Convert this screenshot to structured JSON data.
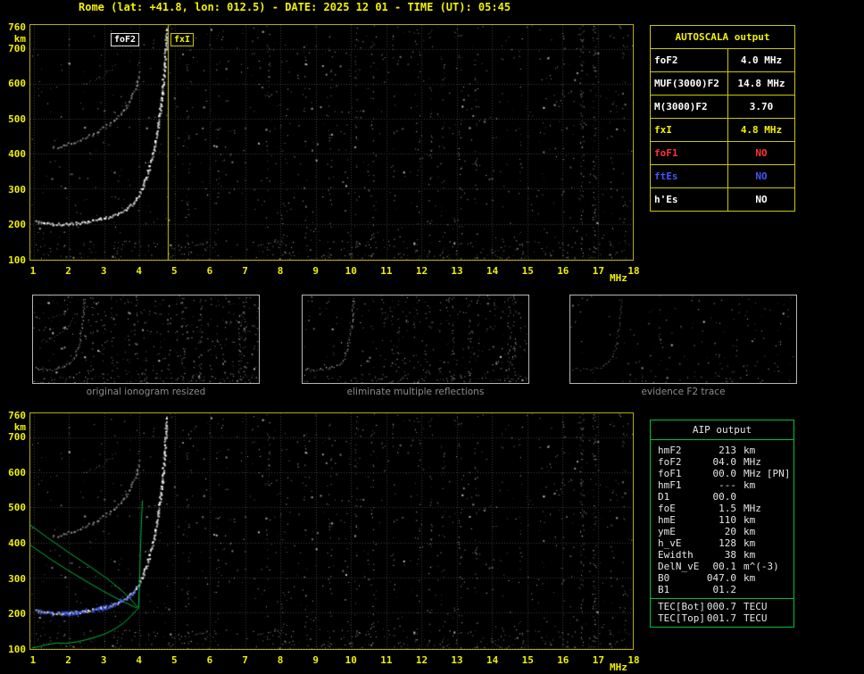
{
  "title": "Rome (lat: +41.8, lon: 012.5) - DATE: 2025 12 01 - TIME (UT): 05:45",
  "colors": {
    "yellow_text": "#f2f200",
    "yellow_border": "#c9c900",
    "green": "#00c040",
    "blue": "#3355ff",
    "red": "#ff3333",
    "ftes_blue": "#4455ff",
    "white": "#ffffff",
    "caption_gray": "#8c8c8c",
    "grid": "#3d3d3d"
  },
  "plot_labels": {
    "foF2": "foF2",
    "fxI": "fxI"
  },
  "axes": {
    "y_unit": "km",
    "x_unit": "MHz",
    "y_ticks": [
      760,
      700,
      600,
      500,
      400,
      300,
      200,
      100
    ],
    "y_grid": [
      100,
      200,
      300,
      400,
      500,
      600,
      700
    ],
    "x_ticks": [
      1,
      2,
      3,
      4,
      5,
      6,
      7,
      8,
      9,
      10,
      11,
      12,
      13,
      14,
      15,
      16,
      17,
      18
    ]
  },
  "autoscala_table": {
    "title": "AUTOSCALA output",
    "rows": [
      {
        "label": "foF2",
        "value": "4.0 MHz",
        "color": "#ffffff"
      },
      {
        "label": "MUF(3000)F2",
        "value": "14.8 MHz",
        "color": "#ffffff"
      },
      {
        "label": "M(3000)F2",
        "value": "3.70",
        "color": "#ffffff"
      },
      {
        "label": "fxI",
        "value": "4.8 MHz",
        "color": "#f2f200"
      },
      {
        "label": "foF1",
        "value": "NO",
        "color": "#ff3333"
      },
      {
        "label": "ftEs",
        "value": "NO",
        "color": "#4455ff"
      },
      {
        "label": "h'Es",
        "value": "NO",
        "color": "#ffffff"
      }
    ]
  },
  "thumbnails": [
    {
      "caption": "original ionogram resized"
    },
    {
      "caption": "eliminate multiple reflections"
    },
    {
      "caption": "evidence F2 trace"
    }
  ],
  "aip_table": {
    "title": "AIP output",
    "rows": [
      {
        "name": "hmF2",
        "value": "213",
        "unit": "km",
        "extra": ""
      },
      {
        "name": "foF2",
        "value": "04.0",
        "unit": "MHz",
        "extra": ""
      },
      {
        "name": "foF1",
        "value": "00.0",
        "unit": "MHz",
        "extra": "[PN]"
      },
      {
        "name": "hmF1",
        "value": "---",
        "unit": "km",
        "extra": ""
      },
      {
        "name": "D1",
        "value": "00.0",
        "unit": "",
        "extra": ""
      },
      {
        "name": "foE",
        "value": "1.5",
        "unit": "MHz",
        "extra": ""
      },
      {
        "name": "hmE",
        "value": "110",
        "unit": "km",
        "extra": ""
      },
      {
        "name": "ymE",
        "value": "20",
        "unit": "km",
        "extra": ""
      },
      {
        "name": "h_vE",
        "value": "128",
        "unit": "km",
        "extra": ""
      },
      {
        "name": "Ewidth",
        "value": "38",
        "unit": "km",
        "extra": ""
      },
      {
        "name": "DelN_vE",
        "value": "00.1",
        "unit": "m^(-3)",
        "extra": ""
      },
      {
        "name": "B0",
        "value": "047.0",
        "unit": "km",
        "extra": ""
      },
      {
        "name": "B1",
        "value": "01.2",
        "unit": "",
        "extra": ""
      }
    ],
    "tec_rows": [
      {
        "name": "TEC[Bot]",
        "value": "000.7",
        "unit": "TECU"
      },
      {
        "name": "TEC[Top]",
        "value": "001.7",
        "unit": "TECU"
      }
    ]
  },
  "ionogram": {
    "fmin": 0.9,
    "fmax": 18.0,
    "hmin": 97,
    "hmax": 768,
    "foF2_mhz": 4.0,
    "fxI_mhz": 4.8,
    "seed": 11,
    "traces": {
      "f2": [
        [
          1.05,
          207
        ],
        [
          1.4,
          201
        ],
        [
          1.8,
          200
        ],
        [
          2.2,
          203
        ],
        [
          2.6,
          209
        ],
        [
          3.0,
          217
        ],
        [
          3.3,
          227
        ],
        [
          3.6,
          241
        ],
        [
          3.8,
          259
        ],
        [
          3.95,
          281
        ],
        [
          4.1,
          312
        ],
        [
          4.25,
          355
        ],
        [
          4.4,
          410
        ],
        [
          4.5,
          470
        ],
        [
          4.62,
          560
        ],
        [
          4.7,
          650
        ],
        [
          4.75,
          760
        ]
      ],
      "hop2": [
        [
          1.5,
          418
        ],
        [
          1.9,
          428
        ],
        [
          2.3,
          442
        ],
        [
          2.7,
          460
        ],
        [
          3.0,
          478
        ],
        [
          3.3,
          500
        ],
        [
          3.55,
          528
        ],
        [
          3.75,
          560
        ],
        [
          3.9,
          600
        ],
        [
          4.0,
          640
        ]
      ],
      "hop3": [
        [
          2.4,
          598
        ],
        [
          2.7,
          610
        ],
        [
          3.0,
          625
        ],
        [
          3.2,
          642
        ],
        [
          3.35,
          660
        ]
      ]
    },
    "green_paths": [
      [
        [
          0.95,
          100
        ],
        [
          1.15,
          104
        ],
        [
          1.4,
          110
        ],
        [
          1.65,
          114
        ],
        [
          1.9,
          113
        ],
        [
          2.2,
          117
        ],
        [
          2.6,
          126
        ],
        [
          3.0,
          139
        ],
        [
          3.3,
          154
        ],
        [
          3.55,
          171
        ],
        [
          3.75,
          190
        ],
        [
          3.9,
          207
        ],
        [
          3.97,
          213
        ]
      ],
      [
        [
          3.97,
          213
        ],
        [
          4.0,
          290
        ],
        [
          4.02,
          370
        ],
        [
          4.05,
          450
        ],
        [
          4.08,
          520
        ]
      ],
      [
        [
          0.9,
          450
        ],
        [
          1.4,
          413
        ],
        [
          2.0,
          371
        ],
        [
          2.6,
          331
        ],
        [
          3.1,
          296
        ],
        [
          3.5,
          263
        ],
        [
          3.75,
          239
        ],
        [
          3.95,
          215
        ]
      ],
      [
        [
          0.9,
          393
        ],
        [
          1.5,
          351
        ],
        [
          2.1,
          313
        ],
        [
          2.7,
          277
        ],
        [
          3.2,
          249
        ],
        [
          3.6,
          229
        ],
        [
          3.92,
          214
        ]
      ]
    ],
    "blue_range": [
      1.05,
      3.95
    ],
    "streak_freqs": [
      5.35,
      6.2,
      6.9,
      7.65,
      8.15,
      8.7,
      9.4,
      10.15,
      10.6,
      11.2,
      11.9,
      12.25,
      12.6,
      13.1,
      13.55,
      14.25,
      14.8,
      15.4,
      16.0,
      16.55,
      16.9,
      17.4,
      17.75
    ],
    "streak_strong": [
      12.25,
      13.55,
      16.55,
      16.9
    ]
  }
}
